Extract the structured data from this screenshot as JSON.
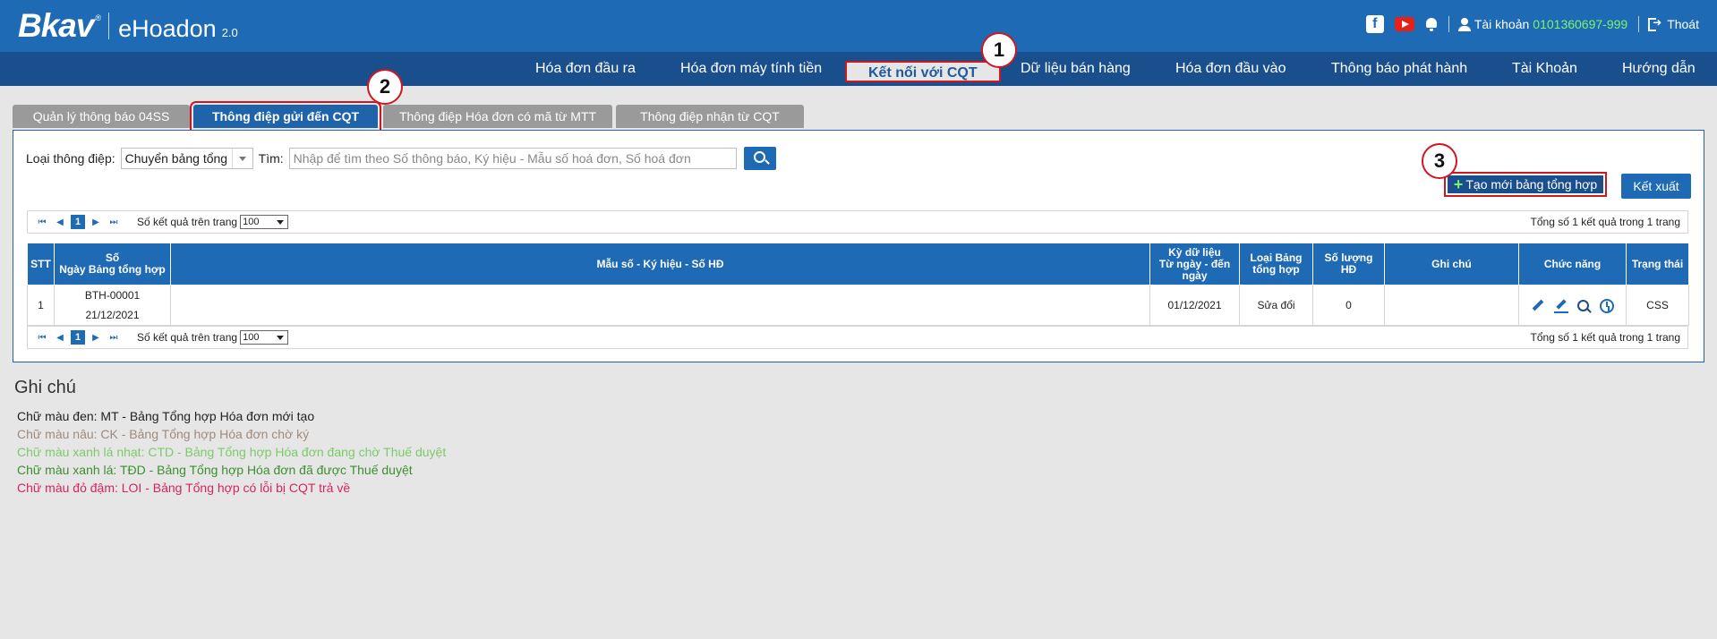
{
  "header": {
    "brand": "Bkav",
    "reg": "®",
    "product": "eHoadon",
    "version": "2.0",
    "account_label": "Tài khoản",
    "account_value": "0101360697-999",
    "logout_label": "Thoát"
  },
  "nav": {
    "items": [
      {
        "label": "Hóa đơn đầu ra"
      },
      {
        "label": "Hóa đơn máy tính tiền"
      },
      {
        "label": "Kết nối với CQT"
      },
      {
        "label": "Dữ liệu bán hàng"
      },
      {
        "label": "Hóa đơn đầu vào"
      },
      {
        "label": "Thông báo phát hành"
      },
      {
        "label": "Tài Khoản"
      },
      {
        "label": "Hướng dẫn"
      }
    ],
    "active": "Kết nối với CQT"
  },
  "tabs": [
    {
      "label": "Quản lý thông báo 04SS"
    },
    {
      "label": "Thông điệp gửi đến CQT"
    },
    {
      "label": "Thông điệp Hóa đơn có mã từ MTT"
    },
    {
      "label": "Thông điệp nhận từ CQT"
    }
  ],
  "filter": {
    "type_label": "Loại thông điệp:",
    "type_value": "Chuyển bảng tổng",
    "search_label": "Tìm:",
    "search_placeholder": "Nhập để tìm theo Số thông báo, Ký hiệu - Mẫu số hoá đơn, Số hoá đơn"
  },
  "buttons": {
    "create": "Tạo mới bảng tổng hợp",
    "export": "Kết xuất"
  },
  "pager": {
    "current_page": "1",
    "per_page_label": "Số kết quả trên trang",
    "per_page_value": "100",
    "total_text": "Tổng số 1 kết quả trong 1 trang"
  },
  "table": {
    "headers": {
      "stt": "STT",
      "so_1": "Số",
      "so_2": "Ngày Bảng tổng hợp",
      "mau_so": "Mẫu số - Ký hiệu - Số HĐ",
      "ky_1": "Kỳ dữ liệu",
      "ky_2": "Từ ngày - đến",
      "ky_3": "ngày",
      "loai_1": "Loại Bảng",
      "loai_2": "tổng hợp",
      "sl_1": "Số lượng",
      "sl_2": "HĐ",
      "ghi_chu": "Ghi chú",
      "chuc_nang": "Chức năng",
      "trang_thai": "Trạng thái"
    },
    "rows": [
      {
        "stt": "1",
        "so": "BTH-00001",
        "ngay": "21/12/2021",
        "mau_so": "",
        "ky": "01/12/2021",
        "loai": "Sửa đổi",
        "so_luong": "0",
        "ghi_chu": "",
        "trang_thai": "CSS"
      }
    ]
  },
  "notes": {
    "title": "Ghi chú",
    "lines": [
      {
        "text": "Chữ màu đen: MT - Bảng Tổng hợp Hóa đơn mới tạo",
        "color": "#222222"
      },
      {
        "text": "Chữ màu nâu: CK - Bảng Tổng hợp Hóa đơn chờ ký",
        "color": "#a08a7a"
      },
      {
        "text": "Chữ màu xanh lá nhạt: CTD - Bảng Tổng hợp Hóa đơn đang chờ Thuế duyệt",
        "color": "#7dc96b"
      },
      {
        "text": "Chữ màu xanh lá: TĐD - Bảng Tổng hợp Hóa đơn đã được Thuế duyệt",
        "color": "#3c8f2f"
      },
      {
        "text": "Chữ màu đỏ đậm: LOI - Bảng Tổng hợp có lỗi bị CQT trả về",
        "color": "#d6245c"
      }
    ]
  },
  "badges": [
    "1",
    "2",
    "3"
  ],
  "colors": {
    "header_bg": "#1f6ab5",
    "nav_bg": "#1a4f8e",
    "highlight": "#d0161f"
  }
}
